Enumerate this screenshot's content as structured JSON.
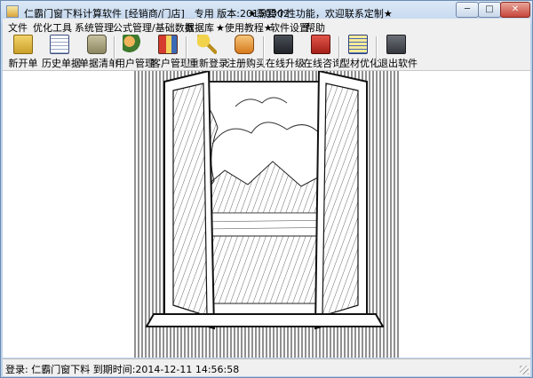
{
  "window": {
    "title": "仁霸门窗下料计算软件 [经销商/门店]__专用 版本:20150302",
    "banner": "★需要个性功能，欢迎联系定制★"
  },
  "window_buttons": {
    "minimize": "─",
    "maximize": "□",
    "close": "✕"
  },
  "menu": [
    "文件",
    "优化工具",
    "系统管理",
    "公式管理/基础数据",
    "数据库",
    "★使用教程★",
    "软件设置",
    "帮助"
  ],
  "toolbar": [
    {
      "label": "新开单",
      "icon": "clipboard-icon"
    },
    {
      "label": "历史单据",
      "icon": "notebook-icon"
    },
    {
      "label": "单据清单",
      "icon": "briefcase-icon"
    },
    {
      "label": "用户管理",
      "icon": "users-icon"
    },
    {
      "label": "客户管理",
      "icon": "address-book-icon"
    },
    {
      "label": "重新登录",
      "icon": "keys-icon"
    },
    {
      "label": "注册购买",
      "icon": "register-icon"
    },
    {
      "label": "在线升级",
      "icon": "update-icon"
    },
    {
      "label": "在线咨询",
      "icon": "chat-icon"
    },
    {
      "label": "型材优化",
      "icon": "profile-icon"
    },
    {
      "label": "退出软件",
      "icon": "exit-icon"
    }
  ],
  "status": {
    "text": "登录: 仁霸门窗下料 到期时间:2014-12-11 14:56:58"
  },
  "colors": {
    "titlebar": "#c2d6ee",
    "menubar": "#f0f0f0",
    "close_button": "#c6443a"
  }
}
